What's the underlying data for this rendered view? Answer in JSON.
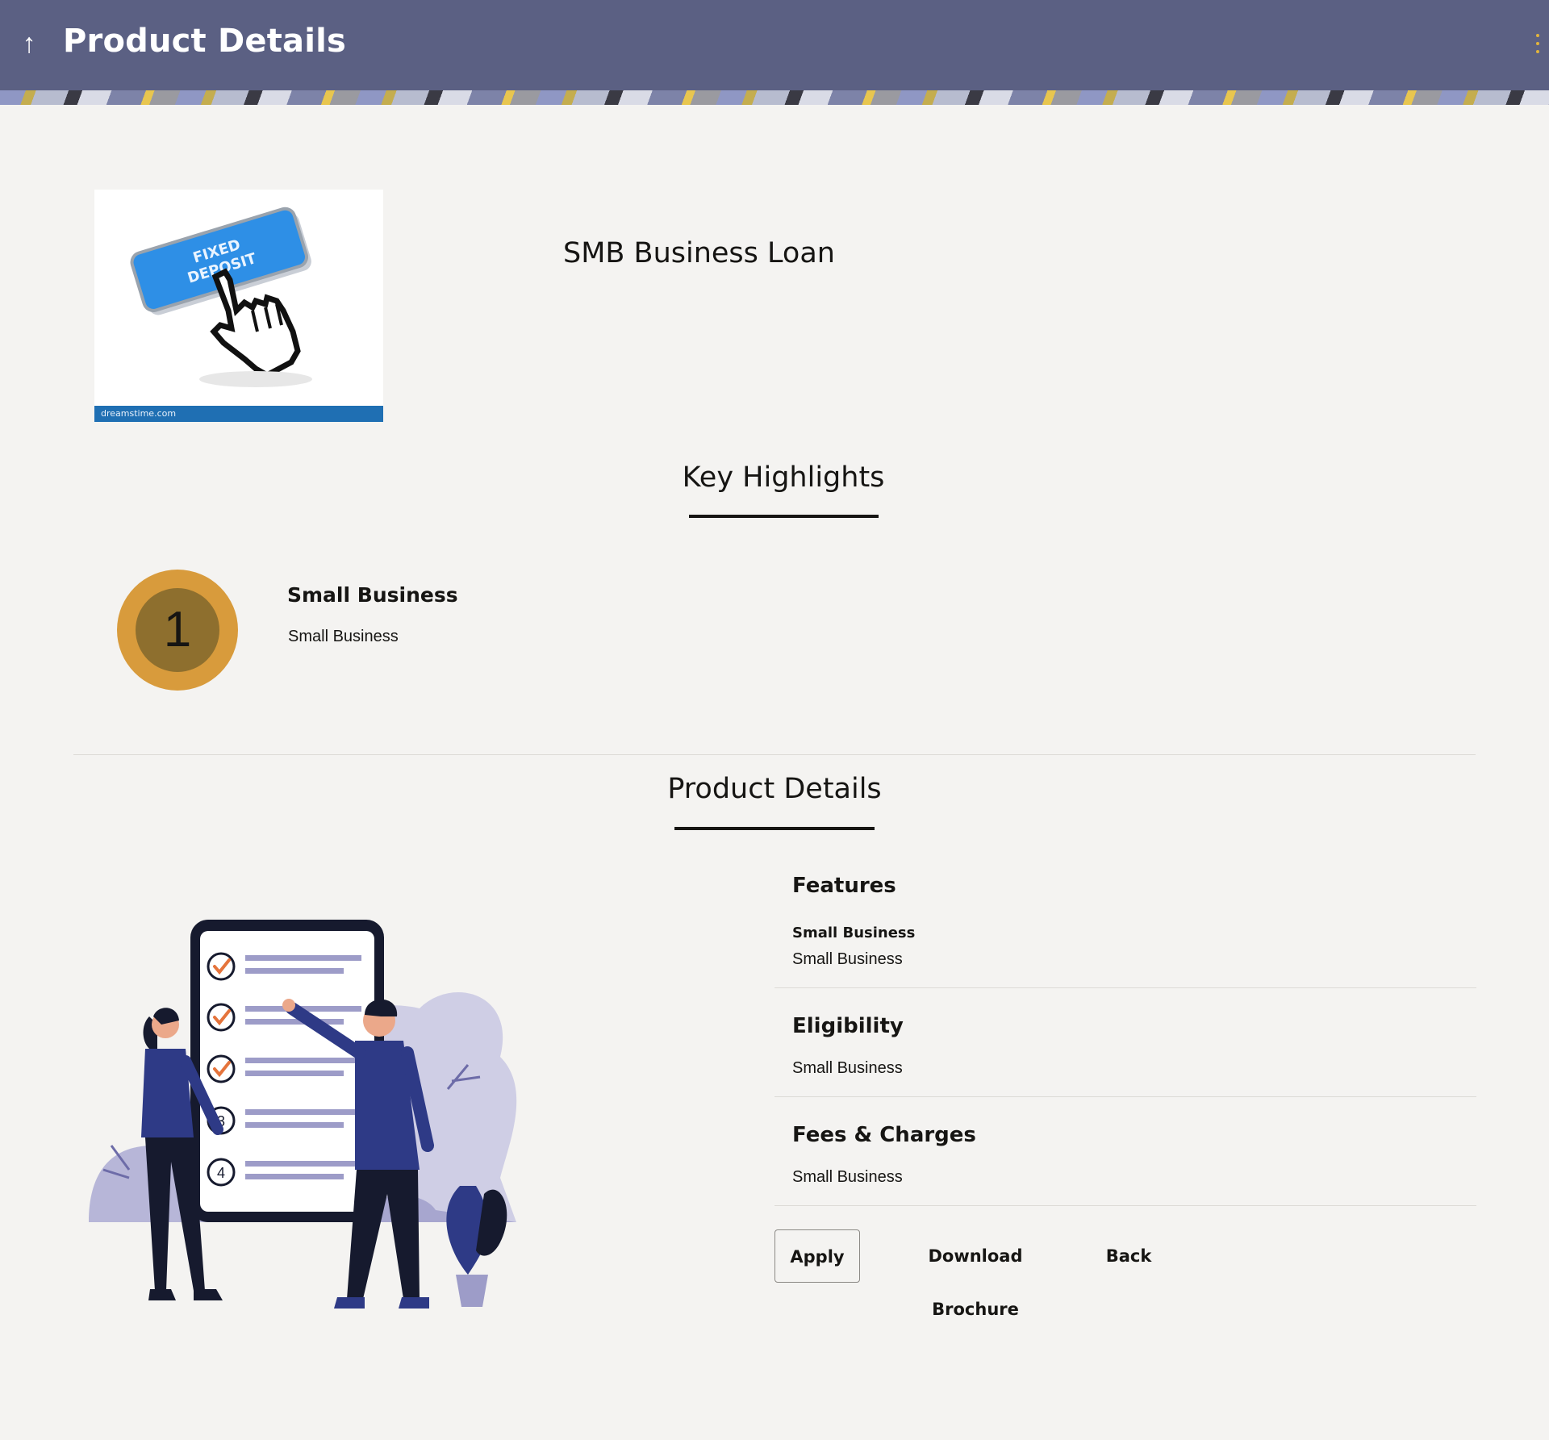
{
  "header": {
    "title": "Product Details",
    "back_icon": "up-arrow-icon",
    "menu_icon": "kebab-menu-icon",
    "background_color": "#5b6083",
    "accent_color": "#e2b43c"
  },
  "product": {
    "name": "SMB Business Loan",
    "image": {
      "button_text_line1": "FIXED",
      "button_text_line2": "DEPOSIT",
      "watermark": "dreamstime.com"
    }
  },
  "key_highlights": {
    "heading": "Key Highlights",
    "items": [
      {
        "number": "1",
        "title": "Small Business",
        "description": "Small Business"
      }
    ]
  },
  "product_details": {
    "heading": "Product Details",
    "sections": [
      {
        "title": "Features",
        "subtitle": "Small Business",
        "text": "Small Business"
      },
      {
        "title": "Eligibility",
        "text": "Small Business"
      },
      {
        "title": "Fees & Charges",
        "text": "Small Business"
      }
    ]
  },
  "illustration": {
    "steps": [
      "3",
      "4"
    ]
  },
  "actions": {
    "apply": "Apply",
    "download": "Download Brochure",
    "back": "Back"
  }
}
